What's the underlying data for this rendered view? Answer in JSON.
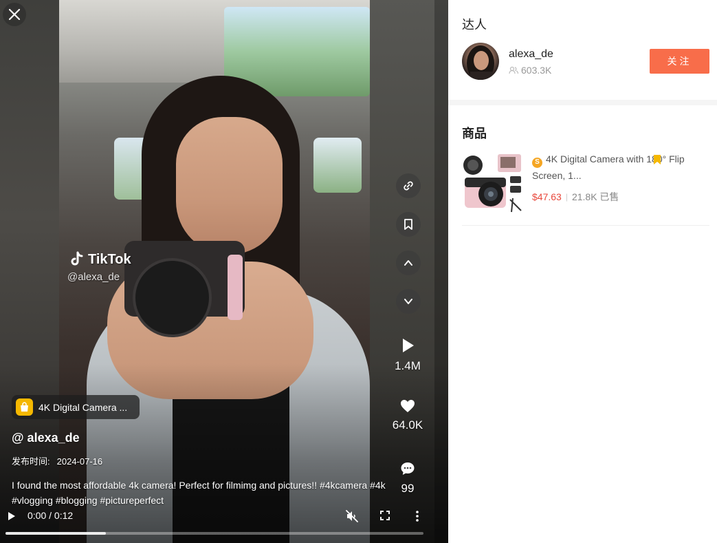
{
  "video": {
    "watermark_logo": "TikTok",
    "watermark_handle": "@alexa_de",
    "product_pill": "4K Digital Camera ...",
    "author_handle": "@ alexa_de",
    "publish_label": "发布时间:",
    "publish_date": "2024-07-16",
    "caption": "I found the most affordable 4k camera! Perfect for filmimg and pictures!! #4kcamera #4k #vlogging #blogging #pictureperfect",
    "time": "0:00 / 0:12",
    "progress_fraction": 0.24,
    "stats": {
      "plays": "1.4M",
      "likes": "64.0K",
      "comments": "99"
    }
  },
  "panel": {
    "talent_title": "达人",
    "name": "alexa_de",
    "followers": "603.3K",
    "follow_label": "关注",
    "goods_title": "商品",
    "product": {
      "title": "4K Digital Camera with 180° Flip Screen, 1...",
      "coin_symbol": "S",
      "price": "$47.63",
      "sold": "21.8K 已售"
    }
  },
  "colors": {
    "follow_button": "#f86d4a",
    "price": "#e8473b",
    "bag_badge": "#f5b800",
    "bookmark_flag": "#f5b800"
  }
}
